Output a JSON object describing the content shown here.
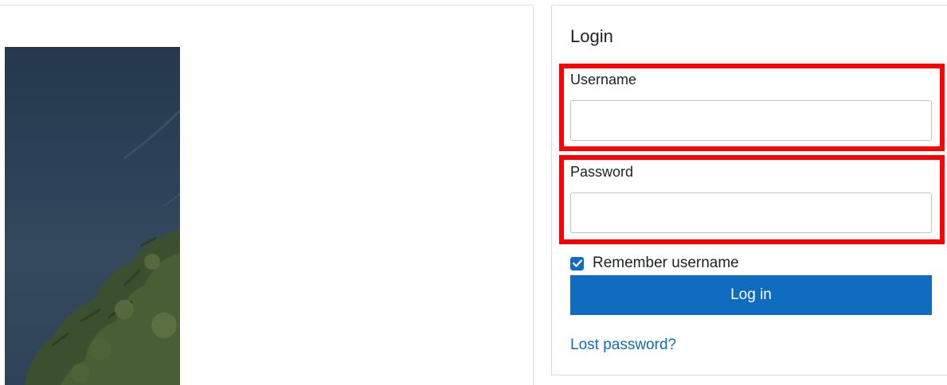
{
  "login": {
    "title": "Login",
    "username_label": "Username",
    "username_value": "",
    "password_label": "Password",
    "password_value": "",
    "remember_label": "Remember username",
    "remember_checked": true,
    "submit_label": "Log in",
    "lost_password_link": "Lost password?"
  },
  "colors": {
    "accent": "#0f6cbf",
    "highlight": "#ff0000"
  }
}
